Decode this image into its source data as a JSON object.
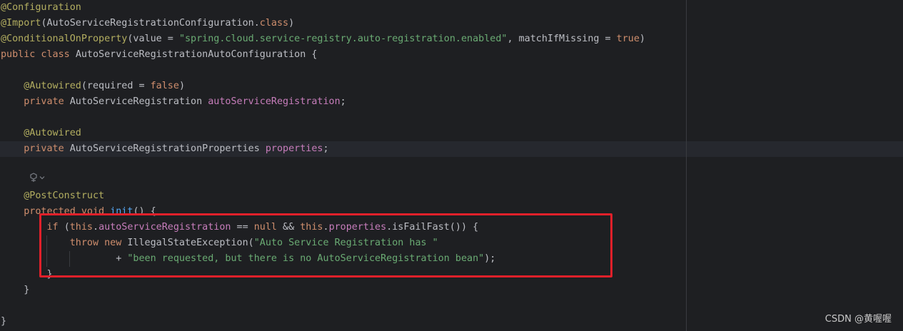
{
  "lines": [
    [
      {
        "t": "@Configuration",
        "c": "ann"
      }
    ],
    [
      {
        "t": "@Import",
        "c": "ann"
      },
      {
        "t": "(AutoServiceRegistrationConfiguration.",
        "c": "plain"
      },
      {
        "t": "class",
        "c": "kw"
      },
      {
        "t": ")",
        "c": "plain"
      }
    ],
    [
      {
        "t": "@ConditionalOnProperty",
        "c": "ann"
      },
      {
        "t": "(value = ",
        "c": "plain"
      },
      {
        "t": "\"spring.cloud.service-registry.auto-registration.enabled\"",
        "c": "str"
      },
      {
        "t": ", matchIfMissing = ",
        "c": "plain"
      },
      {
        "t": "true",
        "c": "kw"
      },
      {
        "t": ")",
        "c": "plain"
      }
    ],
    [
      {
        "t": "public class ",
        "c": "kw"
      },
      {
        "t": "AutoServiceRegistrationAutoConfiguration {",
        "c": "plain"
      }
    ],
    [],
    [
      {
        "t": "    ",
        "c": "plain"
      },
      {
        "t": "@Autowired",
        "c": "ann"
      },
      {
        "t": "(required = ",
        "c": "plain"
      },
      {
        "t": "false",
        "c": "kw"
      },
      {
        "t": ")",
        "c": "plain"
      }
    ],
    [
      {
        "t": "    ",
        "c": "plain"
      },
      {
        "t": "private ",
        "c": "kw"
      },
      {
        "t": "AutoServiceRegistration ",
        "c": "plain"
      },
      {
        "t": "autoServiceRegistration",
        "c": "fld"
      },
      {
        "t": ";",
        "c": "plain"
      }
    ],
    [],
    [
      {
        "t": "    ",
        "c": "plain"
      },
      {
        "t": "@Autowired",
        "c": "ann"
      }
    ],
    [
      {
        "t": "    ",
        "c": "plain"
      },
      {
        "t": "private ",
        "c": "kw"
      },
      {
        "t": "AutoServiceRegistrationProperties ",
        "c": "plain"
      },
      {
        "t": "properties",
        "c": "fld"
      },
      {
        "t": ";",
        "c": "plain"
      }
    ],
    [],
    [],
    [
      {
        "t": "    ",
        "c": "plain"
      },
      {
        "t": "@PostConstruct",
        "c": "ann"
      }
    ],
    [
      {
        "t": "    ",
        "c": "plain"
      },
      {
        "t": "protected void ",
        "c": "kw"
      },
      {
        "t": "init",
        "c": "fn"
      },
      {
        "t": "() {",
        "c": "plain"
      }
    ],
    [
      {
        "t": "        ",
        "c": "plain"
      },
      {
        "t": "if ",
        "c": "kw"
      },
      {
        "t": "(",
        "c": "plain"
      },
      {
        "t": "this",
        "c": "kw"
      },
      {
        "t": ".",
        "c": "plain"
      },
      {
        "t": "autoServiceRegistration",
        "c": "fld"
      },
      {
        "t": " == ",
        "c": "plain"
      },
      {
        "t": "null",
        "c": "kw"
      },
      {
        "t": " && ",
        "c": "plain"
      },
      {
        "t": "this",
        "c": "kw"
      },
      {
        "t": ".",
        "c": "plain"
      },
      {
        "t": "properties",
        "c": "fld"
      },
      {
        "t": ".isFailFast()) {",
        "c": "plain"
      }
    ],
    [
      {
        "t": "            ",
        "c": "plain"
      },
      {
        "t": "throw new ",
        "c": "kw"
      },
      {
        "t": "IllegalStateException(",
        "c": "plain"
      },
      {
        "t": "\"Auto Service Registration has \"",
        "c": "str"
      }
    ],
    [
      {
        "t": "                    + ",
        "c": "plain"
      },
      {
        "t": "\"been requested, but there is no AutoServiceRegistration bean\"",
        "c": "str"
      },
      {
        "t": ");",
        "c": "plain"
      }
    ],
    [
      {
        "t": "        }",
        "c": "plain"
      }
    ],
    [
      {
        "t": "    }",
        "c": "plain"
      }
    ],
    [],
    [
      {
        "t": "}",
        "c": "plain"
      }
    ]
  ],
  "watermark": "CSDN @黄喔喔"
}
